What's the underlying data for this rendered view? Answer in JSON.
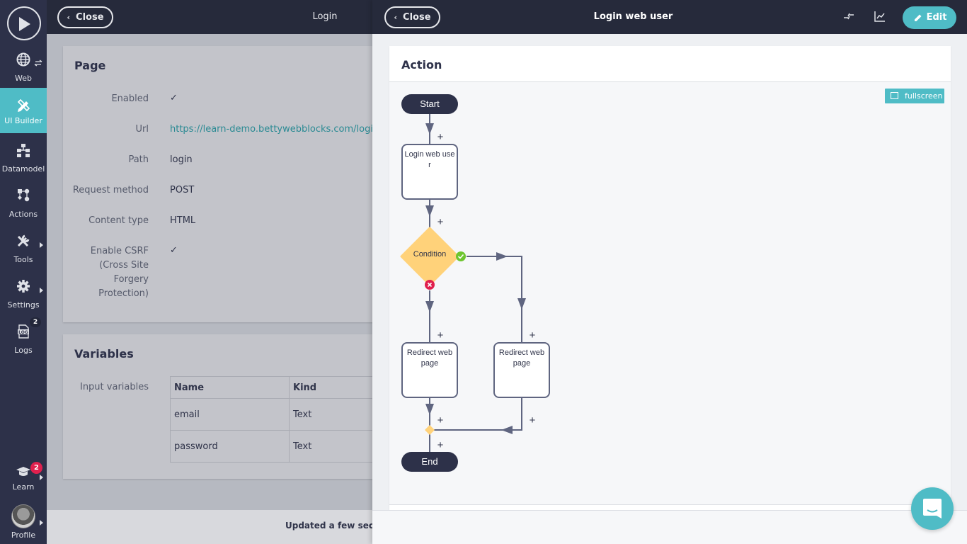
{
  "sidebar": {
    "items": [
      {
        "label": "Web",
        "icon": "globe-icon"
      },
      {
        "label": "UI Builder",
        "icon": "pencil-ruler-icon",
        "active": true
      },
      {
        "label": "Datamodel",
        "icon": "datamodel-icon"
      },
      {
        "label": "Actions",
        "icon": "actions-icon"
      },
      {
        "label": "Tools",
        "icon": "tools-icon"
      },
      {
        "label": "Settings",
        "icon": "gear-icon"
      },
      {
        "label": "Logs",
        "icon": "log-icon",
        "badge": "2"
      },
      {
        "label": "Learn",
        "icon": "graduation-cap-icon",
        "badge": "2"
      },
      {
        "label": "Profile",
        "icon": "avatar"
      }
    ]
  },
  "left": {
    "close_label": "Close",
    "title": "Login",
    "page_card": {
      "title": "Page",
      "rows": [
        {
          "label": "Enabled",
          "value": "✓"
        },
        {
          "label": "Url",
          "value": "https://learn-demo.bettywebblocks.com/login"
        },
        {
          "label": "Path",
          "value": "login"
        },
        {
          "label": "Request method",
          "value": "POST"
        },
        {
          "label": "Content type",
          "value": "HTML"
        },
        {
          "label": "Enable CSRF (Cross Site Forgery Protection)",
          "value": "✓"
        }
      ]
    },
    "variables_card": {
      "title": "Variables",
      "label": "Input variables",
      "columns": [
        "Name",
        "Kind"
      ],
      "rows": [
        [
          "email",
          "Text"
        ],
        [
          "password",
          "Text"
        ]
      ]
    },
    "footer_status": "Updated a few seconds ago"
  },
  "right": {
    "close_label": "Close",
    "title": "Login web user",
    "edit_label": "Edit",
    "action_card_title": "Action",
    "fullscreen_label": "fullscreen",
    "flow": {
      "start": "Start",
      "step1": "Login web user",
      "condition": "Condition",
      "redirect_false": "Redirect web page",
      "redirect_true": "Redirect web page",
      "end": "End",
      "plus": "+"
    }
  },
  "colors": {
    "accent": "#4fbcc6",
    "sidebar_bg": "#2d3149",
    "header_bg": "#262a3b",
    "condition": "#ffd27a",
    "success": "#6dc52f",
    "danger": "#e0204e"
  }
}
